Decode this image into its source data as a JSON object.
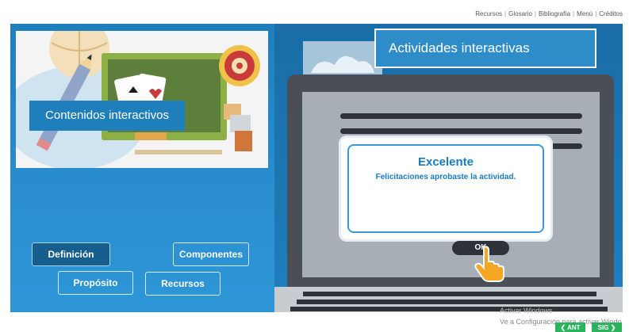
{
  "topnav": {
    "items": [
      "Recursos",
      "Glosario",
      "Bibliografía",
      "Menú",
      "Créditos"
    ]
  },
  "left": {
    "illustration_label": "Contenidos interactivos",
    "buttons": {
      "definicion": "Definición",
      "componentes": "Componentes",
      "proposito": "Propósito",
      "recursos": "Recursos"
    }
  },
  "right": {
    "activities_title": "Actividades interactivas"
  },
  "modal": {
    "title": "Excelente",
    "message": "Felicitaciones aprobaste la actividad.",
    "ok_label": "OK"
  },
  "footer": {
    "watermark_line1": "Activar Windows",
    "watermark_line2": "Ve a Configuración para activar Windo",
    "prev_label": "❮ ANT",
    "next_label": "SIG ❯"
  },
  "colors": {
    "primary_blue": "#1f7fbd",
    "modal_accent": "#1a7bbf",
    "nav_green": "#2db35d"
  }
}
